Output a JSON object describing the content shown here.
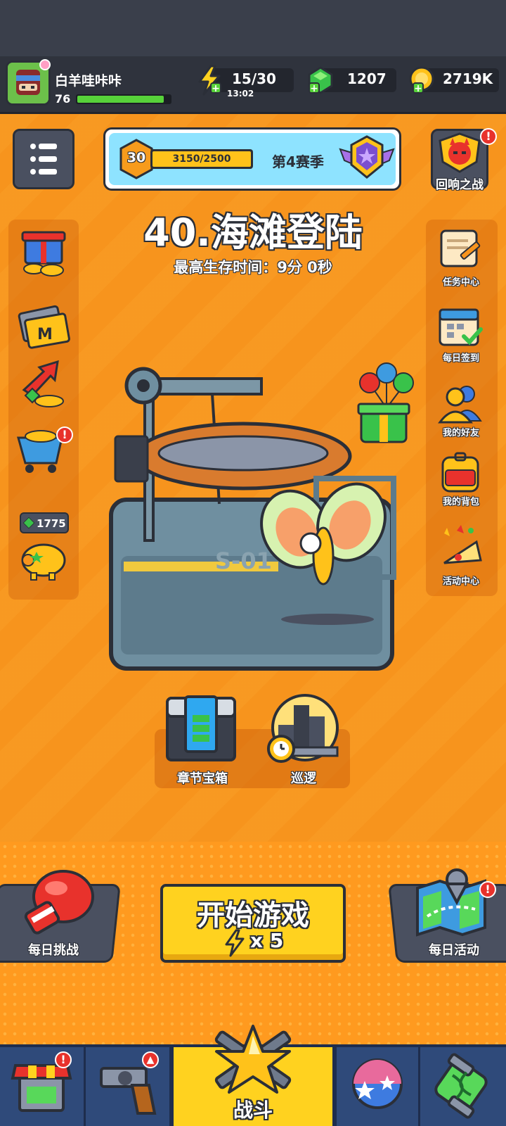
{
  "player": {
    "name": "白羊哇咔咔",
    "level": "76",
    "xp_fraction": 0.93
  },
  "resources": {
    "energy": "15/30",
    "energy_timer": "13:02",
    "gems": "1207",
    "coins": "2719K"
  },
  "season": {
    "level": "30",
    "progress": "3150/2500",
    "progress_fraction": 1.0,
    "label": "第4赛季"
  },
  "echo_battle_label": "回响之战",
  "stage": {
    "title": "40.海滩登陆",
    "best_time": "最高生存时间：9分 0秒",
    "ship_code": "S-01"
  },
  "left_side": {
    "piggy_gems": "1775"
  },
  "right_side": {
    "items": [
      {
        "label": "任务中心",
        "icon": "scroll-icon"
      },
      {
        "label": "每日签到",
        "icon": "calendar-icon"
      },
      {
        "label": "我的好友",
        "icon": "friends-icon"
      },
      {
        "label": "我的背包",
        "icon": "backpack-icon"
      },
      {
        "label": "活动中心",
        "icon": "party-horn-icon"
      }
    ]
  },
  "chapter_chest_label": "章节宝箱",
  "patrol_label": "巡逻",
  "daily_challenge_label": "每日挑战",
  "daily_event_label": "每日活动",
  "start_button": {
    "label": "开始游戏",
    "cost": "x 5"
  },
  "bottom_nav": {
    "battle_label": "战斗"
  },
  "colors": {
    "background": "#f7941d",
    "start_button": "#ffd21f",
    "header": "#2f333d",
    "season_panel": "#8ee3ff"
  }
}
